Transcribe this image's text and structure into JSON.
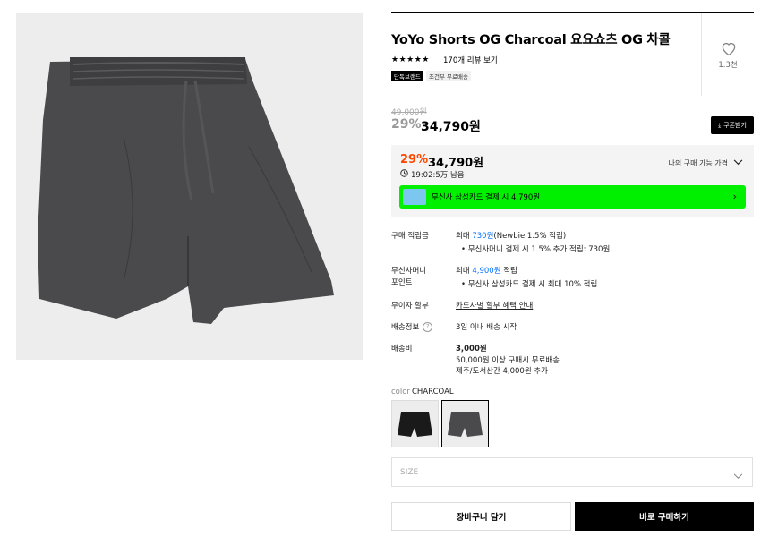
{
  "product": {
    "title": "YoYo Shorts OG Charcoal 요요쇼츠 OG 차콜",
    "stars": "★★★★★",
    "review_link": "170개 리뷰 보기",
    "tag_exclusive": "단독브랜드",
    "tag_shipping": "조건부 무료배송",
    "like_count": "1.3천"
  },
  "price": {
    "original": "49,000원",
    "discount_pct": "29%",
    "sale": "34,790원",
    "coupon_button": "쿠폰받기"
  },
  "best_price": {
    "discount_pct": "29%",
    "price": "34,790원",
    "timer": "19:02:5万 남음",
    "my_best_label": "나의 구매 가능 가격",
    "card_banner": "무신사 삼성카드 결제 시 4,790원"
  },
  "details": {
    "points": {
      "label": "구매 적립금",
      "value_prefix": "최대 ",
      "value_amount": "730원",
      "value_suffix": "(Newbie 1.5% 적립)",
      "bullet": "무신사머니 결제 시 1.5% 추가 적립: 730원"
    },
    "money_points": {
      "label_line1": "무신사머니",
      "label_line2": "포인트",
      "value_prefix": "최대 ",
      "value_amount": "4,900원",
      "value_suffix": " 적립",
      "bullet": "무신사 삼성카드 결제 시 최대 10% 적립"
    },
    "installment": {
      "label": "무이자 할부",
      "link": "카드사별 할부 혜택 안내"
    },
    "shipping_info": {
      "label": "배송정보",
      "value": "3일 이내 배송 시작"
    },
    "shipping_fee": {
      "label": "배송비",
      "fee": "3,000원",
      "line2": "50,000원 이상 구매시 무료배송",
      "line3": "제주/도서산간 4,000원 추가"
    }
  },
  "options": {
    "color_label": "color",
    "color_value": "CHARCOAL",
    "size_placeholder": "SIZE"
  },
  "actions": {
    "cart": "장바구니 담기",
    "buy": "바로 구매하기"
  },
  "colors": {
    "accent_orange": "#ff4800",
    "link_blue": "#0070ff",
    "banner_green": "#00f000",
    "product_charcoal": "#4a4a4c"
  }
}
